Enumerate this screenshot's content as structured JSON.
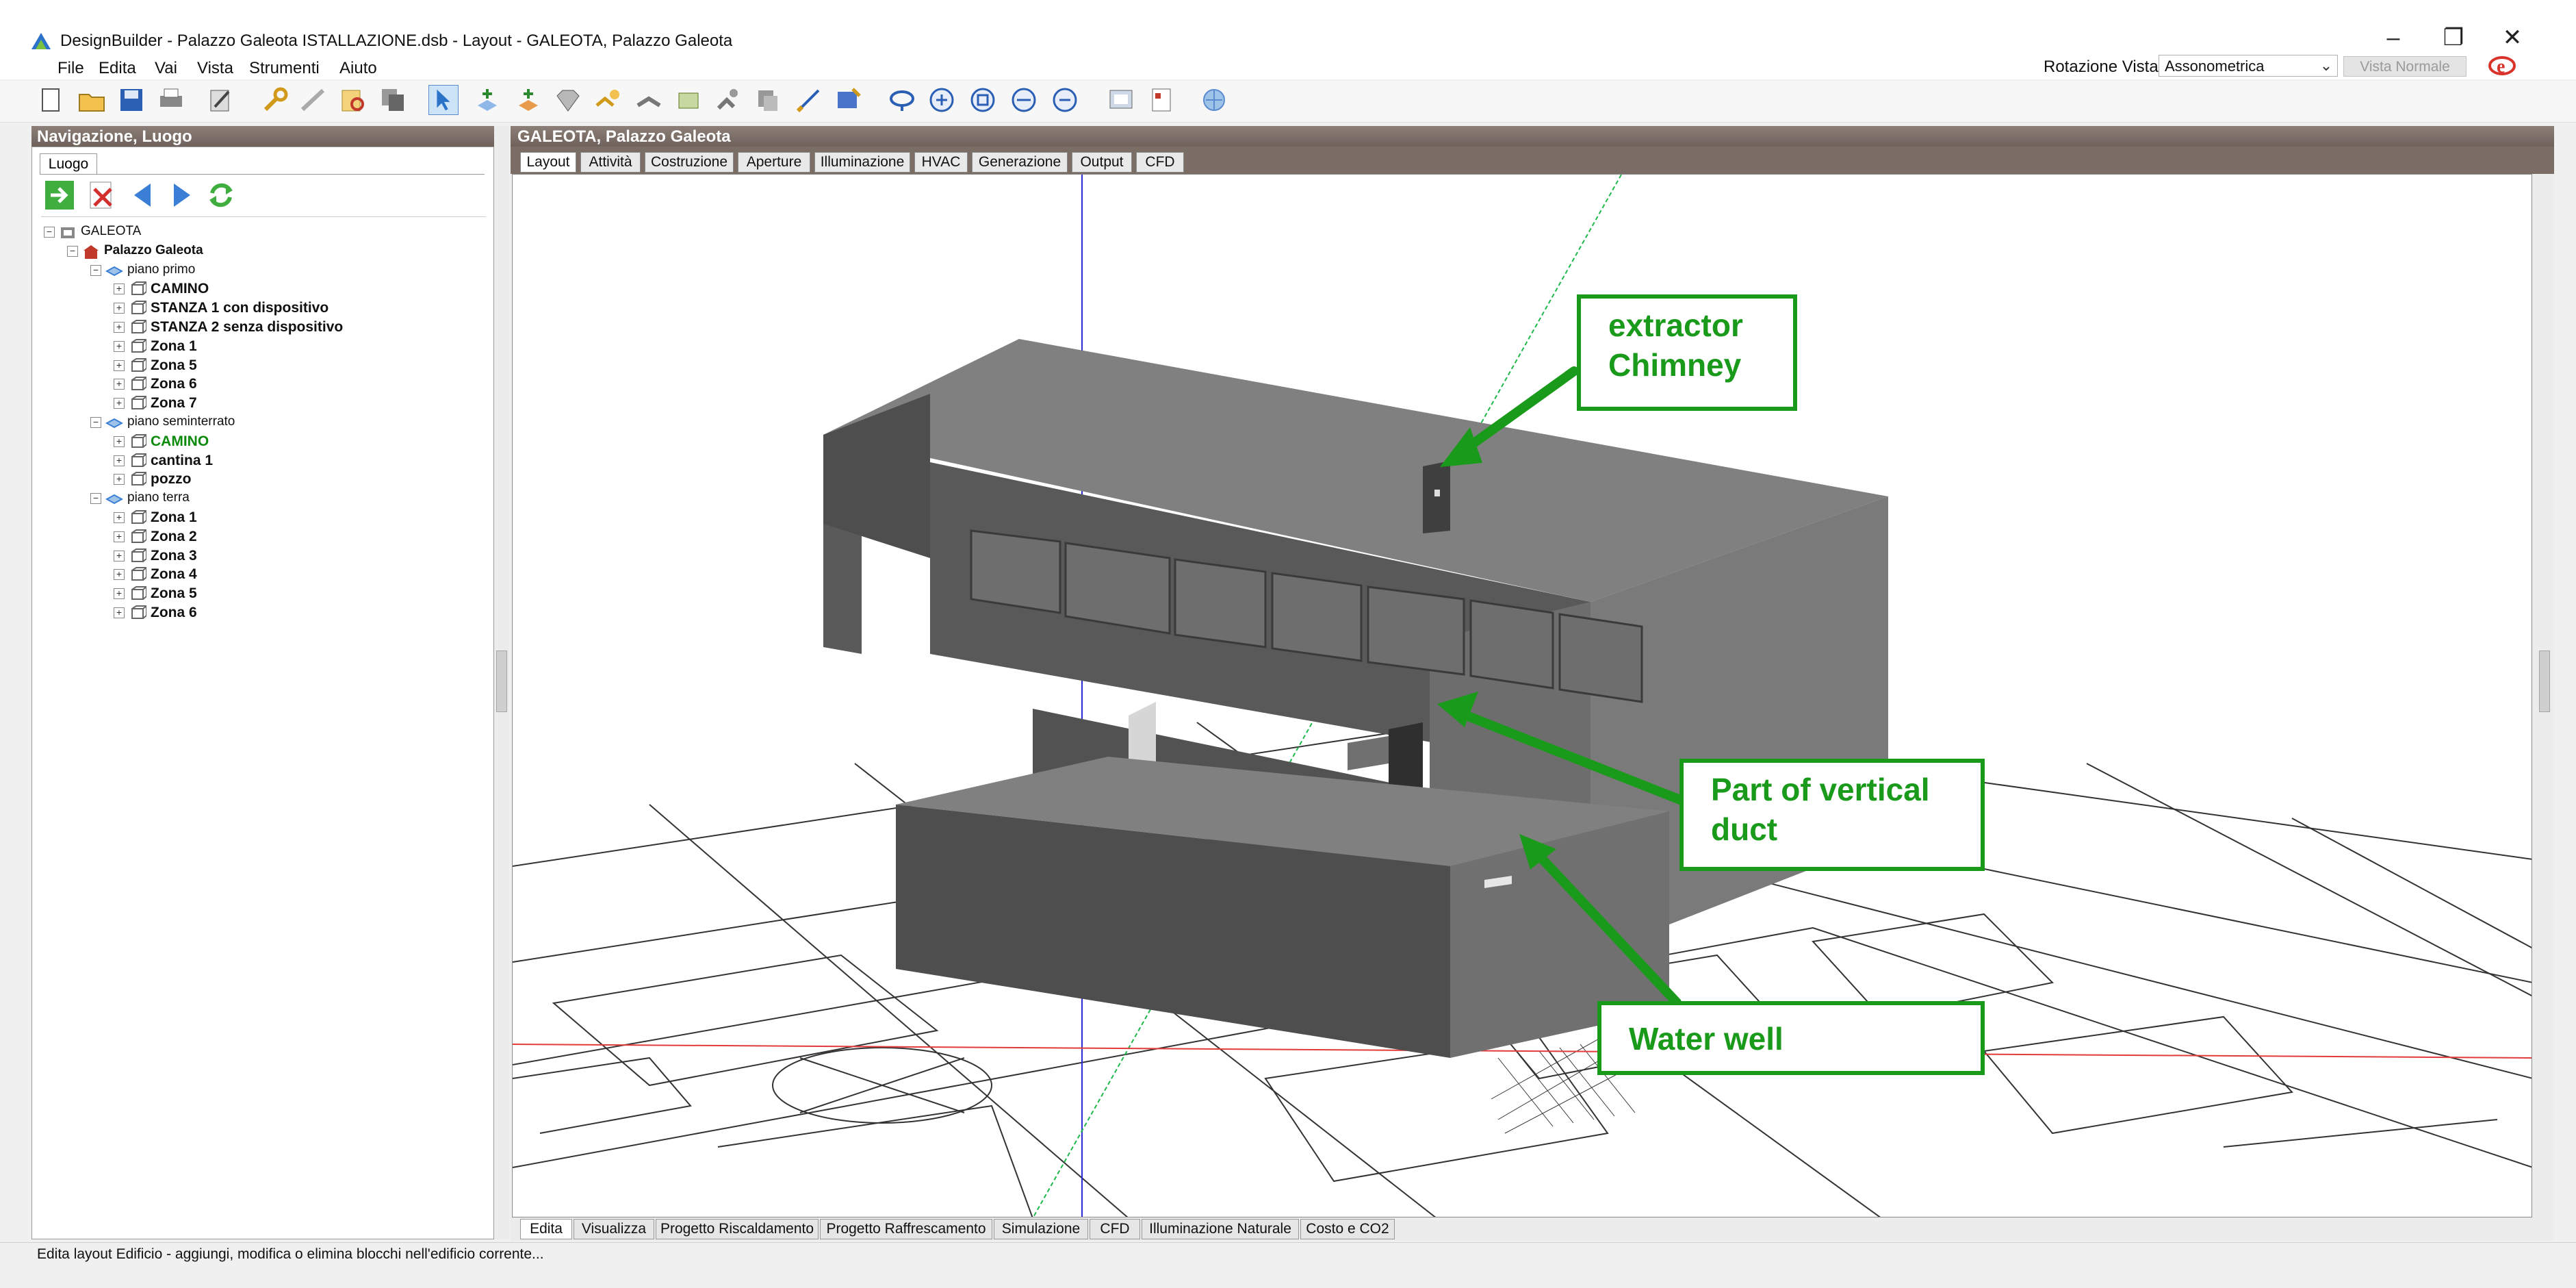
{
  "window": {
    "title": "DesignBuilder - Palazzo Galeota ISTALLAZIONE.dsb - Layout - GALEOTA, Palazzo Galeota",
    "minimize": "–",
    "maximize": "❐",
    "close": "✕"
  },
  "menu": [
    "File",
    "Edita",
    "Vai",
    "Vista",
    "Strumenti",
    "Aiuto"
  ],
  "view_rotation": {
    "label": "Rotazione Vista",
    "value": "Assonometrica",
    "normal_view_button": "Vista Normale"
  },
  "left_panel": {
    "header": "Navigazione, Luogo",
    "tab": "Luogo",
    "tree": [
      {
        "label": "GALEOTA",
        "level": 0,
        "bold": false,
        "icon": "site-icon"
      },
      {
        "label": "Palazzo Galeota",
        "level": 1,
        "bold": true,
        "icon": "building-icon"
      },
      {
        "label": "piano primo",
        "level": 2,
        "bold": false,
        "icon": "floor-icon"
      },
      {
        "label": "CAMINO",
        "level": 3,
        "bold": true,
        "icon": "zone-icon"
      },
      {
        "label": "STANZA 1 con dispositivo",
        "level": 3,
        "bold": true,
        "icon": "zone-icon"
      },
      {
        "label": "STANZA 2 senza dispositivo",
        "level": 3,
        "bold": true,
        "icon": "zone-icon"
      },
      {
        "label": "Zona 1",
        "level": 3,
        "bold": true,
        "icon": "zone-icon"
      },
      {
        "label": "Zona 5",
        "level": 3,
        "bold": true,
        "icon": "zone-icon"
      },
      {
        "label": "Zona 6",
        "level": 3,
        "bold": true,
        "icon": "zone-icon"
      },
      {
        "label": "Zona 7",
        "level": 3,
        "bold": true,
        "icon": "zone-icon"
      },
      {
        "label": "piano seminterrato",
        "level": 2,
        "bold": false,
        "icon": "floor-icon"
      },
      {
        "label": "CAMINO",
        "level": 3,
        "bold": true,
        "green": true,
        "icon": "zone-icon"
      },
      {
        "label": "cantina  1",
        "level": 3,
        "bold": true,
        "icon": "zone-icon"
      },
      {
        "label": "pozzo",
        "level": 3,
        "bold": true,
        "icon": "zone-icon"
      },
      {
        "label": "piano terra",
        "level": 2,
        "bold": false,
        "icon": "floor-icon"
      },
      {
        "label": "Zona 1",
        "level": 3,
        "bold": true,
        "icon": "zone-icon"
      },
      {
        "label": "Zona 2",
        "level": 3,
        "bold": true,
        "icon": "zone-icon"
      },
      {
        "label": "Zona 3",
        "level": 3,
        "bold": true,
        "icon": "zone-icon"
      },
      {
        "label": "Zona 4",
        "level": 3,
        "bold": true,
        "icon": "zone-icon"
      },
      {
        "label": "Zona 5",
        "level": 3,
        "bold": true,
        "icon": "zone-icon"
      },
      {
        "label": "Zona 6",
        "level": 3,
        "bold": true,
        "icon": "zone-icon"
      }
    ]
  },
  "main": {
    "header": "GALEOTA, Palazzo Galeota",
    "tabs": [
      "Layout",
      "Attività",
      "Costruzione",
      "Aperture",
      "Illuminazione",
      "HVAC",
      "Generazione",
      "Output",
      "CFD"
    ],
    "active_tab": "Layout",
    "bottom_tabs": [
      "Edita",
      "Visualizza",
      "Progetto Riscaldamento",
      "Progetto Raffrescamento",
      "Simulazione",
      "CFD",
      "Illuminazione Naturale",
      "Costo e CO2"
    ],
    "active_bottom_tab": "Edita"
  },
  "annotations": {
    "chimney": [
      "extractor",
      "Chimney"
    ],
    "duct": [
      "Part of vertical",
      "duct"
    ],
    "well": "Water well"
  },
  "colors": {
    "annotation": "#1a9a1a",
    "header": "#7a6d66"
  },
  "status": "Edita layout Edificio - aggiungi, modifica o elimina blocchi nell'edificio corrente..."
}
